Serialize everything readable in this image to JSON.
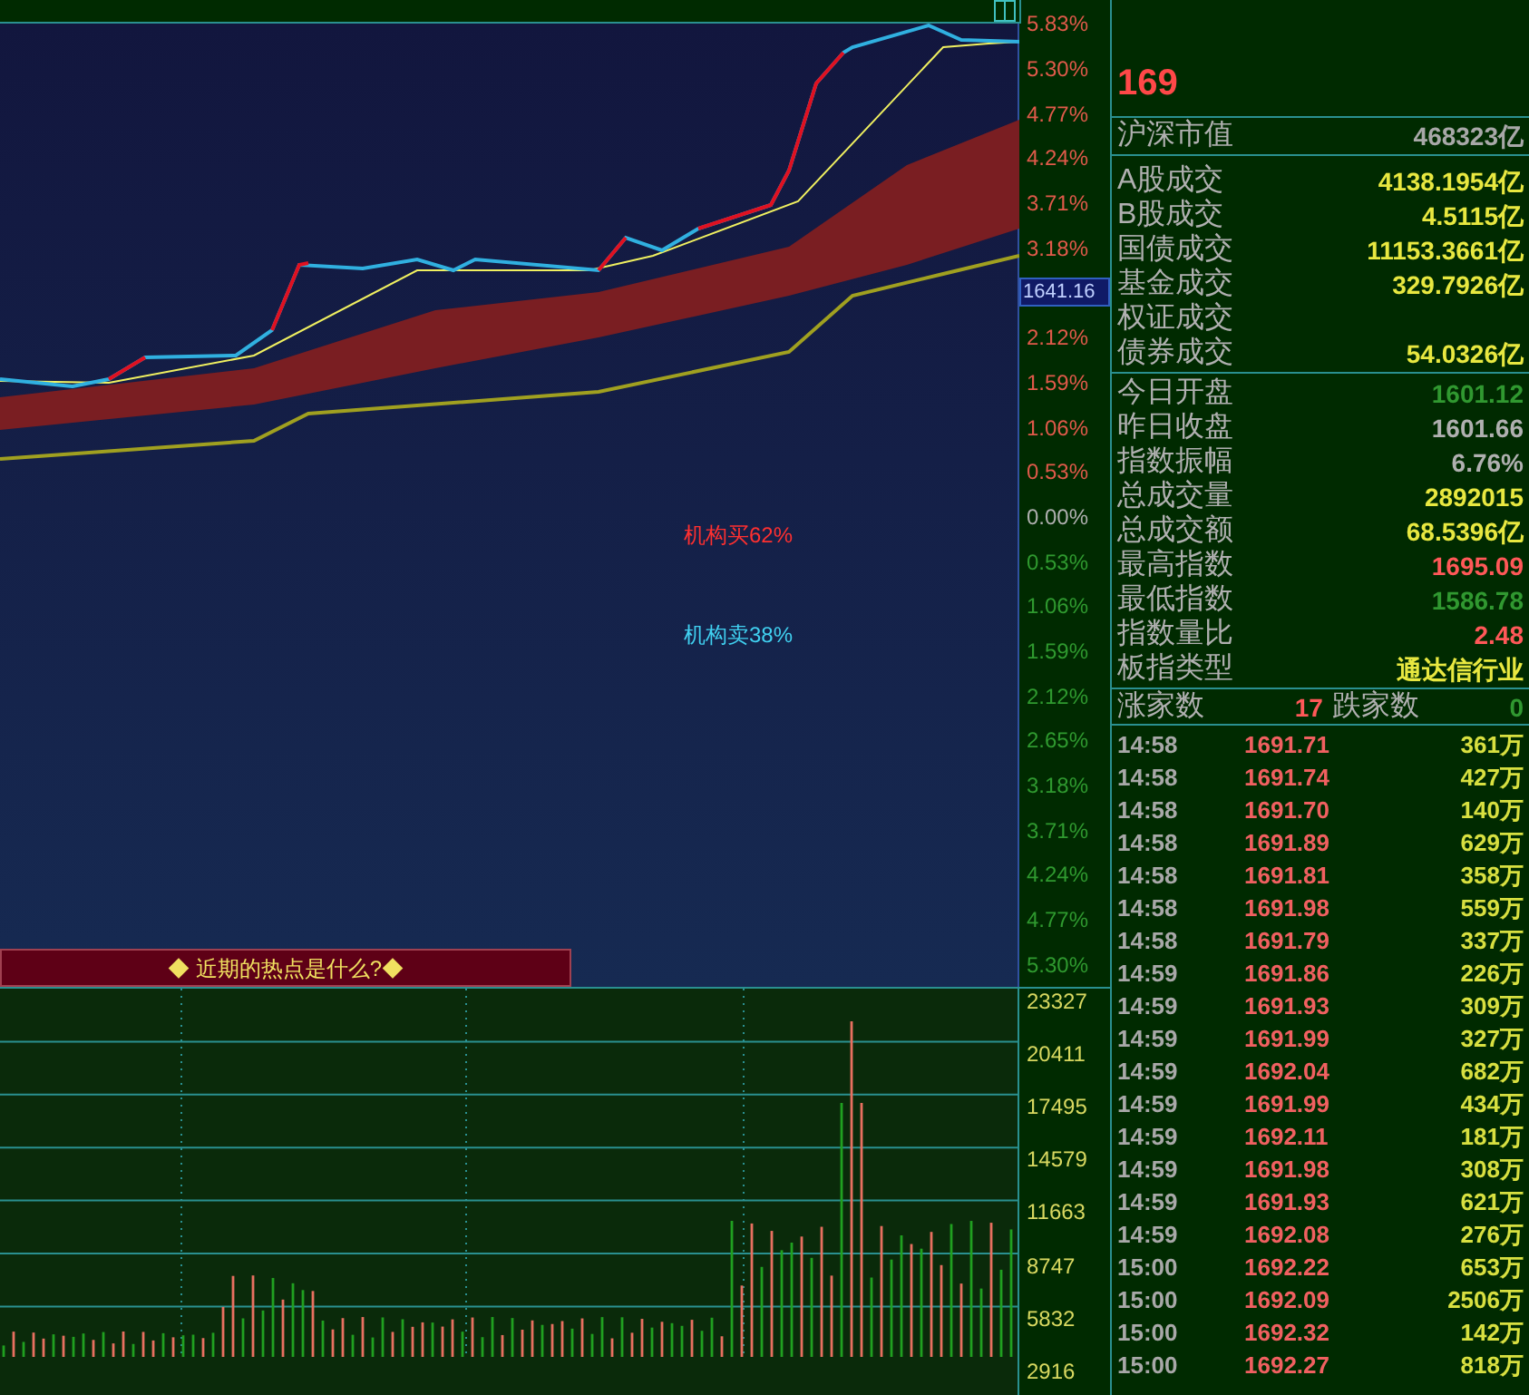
{
  "price_axis": [
    {
      "label": "5.83%",
      "kind": "up"
    },
    {
      "label": "5.30%",
      "kind": "up"
    },
    {
      "label": "4.77%",
      "kind": "up"
    },
    {
      "label": "4.24%",
      "kind": "up"
    },
    {
      "label": "3.71%",
      "kind": "up"
    },
    {
      "label": "3.18%",
      "kind": "up"
    },
    {
      "label": "1641.16",
      "kind": "box"
    },
    {
      "label": "2.12%",
      "kind": "up"
    },
    {
      "label": "1.59%",
      "kind": "up"
    },
    {
      "label": "1.06%",
      "kind": "up"
    },
    {
      "label": "0.53%",
      "kind": "up"
    },
    {
      "label": "0.00%",
      "kind": "flat"
    },
    {
      "label": "0.53%",
      "kind": "down"
    },
    {
      "label": "1.06%",
      "kind": "down"
    },
    {
      "label": "1.59%",
      "kind": "down"
    },
    {
      "label": "2.12%",
      "kind": "down"
    },
    {
      "label": "2.65%",
      "kind": "down"
    },
    {
      "label": "3.18%",
      "kind": "down"
    },
    {
      "label": "3.71%",
      "kind": "down"
    },
    {
      "label": "4.24%",
      "kind": "down"
    },
    {
      "label": "4.77%",
      "kind": "down"
    },
    {
      "label": "5.30%",
      "kind": "down"
    }
  ],
  "signals": [
    {
      "label": "机构买62%",
      "kind": "buy"
    },
    {
      "label": "机构卖38%",
      "kind": "sell"
    }
  ],
  "banner": "◆ 近期的热点是什么?◆",
  "volume_axis": [
    "23327",
    "20411",
    "17495",
    "14579",
    "11663",
    "8747",
    "5832",
    "2916"
  ],
  "quote": {
    "price": "169"
  },
  "market_value": {
    "label": "沪深市值",
    "value": "468323亿",
    "color": "#a8a8a8"
  },
  "turnover": [
    {
      "label": "A股成交",
      "value": "4138.1954亿",
      "color": "#e8e840"
    },
    {
      "label": "B股成交",
      "value": "4.5115亿",
      "color": "#e8e840"
    },
    {
      "label": "国债成交",
      "value": "11153.3661亿",
      "color": "#e8e840"
    },
    {
      "label": "基金成交",
      "value": "329.7926亿",
      "color": "#e8e840"
    },
    {
      "label": "权证成交"
    },
    {
      "label": "债券成交",
      "value": "54.0326亿",
      "color": "#e8e840"
    }
  ],
  "index_stats": [
    {
      "label": "今日开盘",
      "value": "1601.12",
      "color": "#309830"
    },
    {
      "label": "昨日收盘",
      "value": "1601.66",
      "color": "#b0b0b0"
    },
    {
      "label": "指数振幅",
      "value": "6.76%",
      "color": "#b0b0b0"
    },
    {
      "label": "总成交量",
      "value": "2892015",
      "color": "#e8e840"
    },
    {
      "label": "总成交额",
      "value": "68.5396亿",
      "color": "#e8e840"
    },
    {
      "label": "最高指数",
      "value": "1695.09",
      "color": "#ff5858"
    },
    {
      "label": "最低指数",
      "value": "1586.78",
      "color": "#309830"
    },
    {
      "label": "指数量比",
      "value": "2.48",
      "color": "#ff5858"
    },
    {
      "label": "板指类型",
      "value": "通达信行业",
      "color": "#e8e840"
    }
  ],
  "breadth": {
    "up_label": "涨家数",
    "up_count": "17",
    "down_label": "跌家数",
    "down_count": "0"
  },
  "ticks": [
    {
      "time": "14:58",
      "price": "1691.71",
      "volume": "361万"
    },
    {
      "time": "14:58",
      "price": "1691.74",
      "volume": "427万"
    },
    {
      "time": "14:58",
      "price": "1691.70",
      "volume": "140万"
    },
    {
      "time": "14:58",
      "price": "1691.89",
      "volume": "629万"
    },
    {
      "time": "14:58",
      "price": "1691.81",
      "volume": "358万"
    },
    {
      "time": "14:58",
      "price": "1691.98",
      "volume": "559万"
    },
    {
      "time": "14:58",
      "price": "1691.79",
      "volume": "337万"
    },
    {
      "time": "14:59",
      "price": "1691.86",
      "volume": "226万"
    },
    {
      "time": "14:59",
      "price": "1691.93",
      "volume": "309万"
    },
    {
      "time": "14:59",
      "price": "1691.99",
      "volume": "327万"
    },
    {
      "time": "14:59",
      "price": "1692.04",
      "volume": "682万"
    },
    {
      "time": "14:59",
      "price": "1691.99",
      "volume": "434万"
    },
    {
      "time": "14:59",
      "price": "1692.11",
      "volume": "181万"
    },
    {
      "time": "14:59",
      "price": "1691.98",
      "volume": "308万"
    },
    {
      "time": "14:59",
      "price": "1691.93",
      "volume": "621万"
    },
    {
      "time": "14:59",
      "price": "1692.08",
      "volume": "276万"
    },
    {
      "time": "15:00",
      "price": "1692.22",
      "volume": "653万"
    },
    {
      "time": "15:00",
      "price": "1692.09",
      "volume": "2506万"
    },
    {
      "time": "15:00",
      "price": "1692.32",
      "volume": "142万"
    },
    {
      "time": "15:00",
      "price": "1692.27",
      "volume": "818万"
    }
  ]
}
